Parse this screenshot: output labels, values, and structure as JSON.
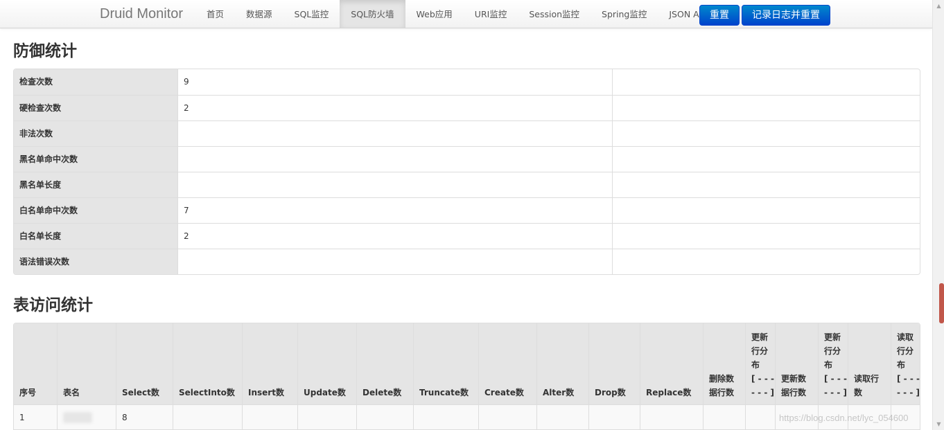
{
  "navbar": {
    "brand": "Druid Monitor",
    "items": [
      "首页",
      "数据源",
      "SQL监控",
      "SQL防火墙",
      "Web应用",
      "URI监控",
      "Session监控",
      "Spring监控",
      "JSON API"
    ],
    "active_index": 3,
    "reset_label": "重置",
    "log_reset_label": "记录日志并重置"
  },
  "defense": {
    "title": "防御统计",
    "rows": [
      {
        "label": "检查次数",
        "value": "9"
      },
      {
        "label": "硬检查次数",
        "value": "2"
      },
      {
        "label": "非法次数",
        "value": ""
      },
      {
        "label": "黑名单命中次数",
        "value": ""
      },
      {
        "label": "黑名单长度",
        "value": ""
      },
      {
        "label": "白名单命中次数",
        "value": "7"
      },
      {
        "label": "白名单长度",
        "value": "2"
      },
      {
        "label": "语法错误次数",
        "value": ""
      }
    ]
  },
  "table_access": {
    "title": "表访问统计",
    "columns": [
      [
        "序号"
      ],
      [
        "表名"
      ],
      [
        "Select数"
      ],
      [
        "SelectInto数"
      ],
      [
        "Insert数"
      ],
      [
        "Update数"
      ],
      [
        "Delete数"
      ],
      [
        "Truncate数"
      ],
      [
        "Create数"
      ],
      [
        "Alter数"
      ],
      [
        "Drop数"
      ],
      [
        "Replace数"
      ],
      [
        "删除数",
        "据行数"
      ],
      [
        "更新",
        "行分",
        "布",
        "[ - - -",
        "- - - ]"
      ],
      [
        "更新数",
        "据行数"
      ],
      [
        "更新",
        "行分",
        "布",
        "[ - - -",
        "- - - ]"
      ],
      [
        "读取行",
        "数"
      ],
      [
        "读取",
        "行分",
        "布",
        "[ - - -",
        "- - - ]"
      ]
    ],
    "rows": [
      [
        "1",
        "",
        "8",
        "",
        "",
        "",
        "",
        "",
        "",
        "",
        "",
        "",
        "",
        "",
        "",
        "",
        "",
        ""
      ]
    ]
  },
  "watermark": "https://blog.csdn.net/lyc_054600"
}
